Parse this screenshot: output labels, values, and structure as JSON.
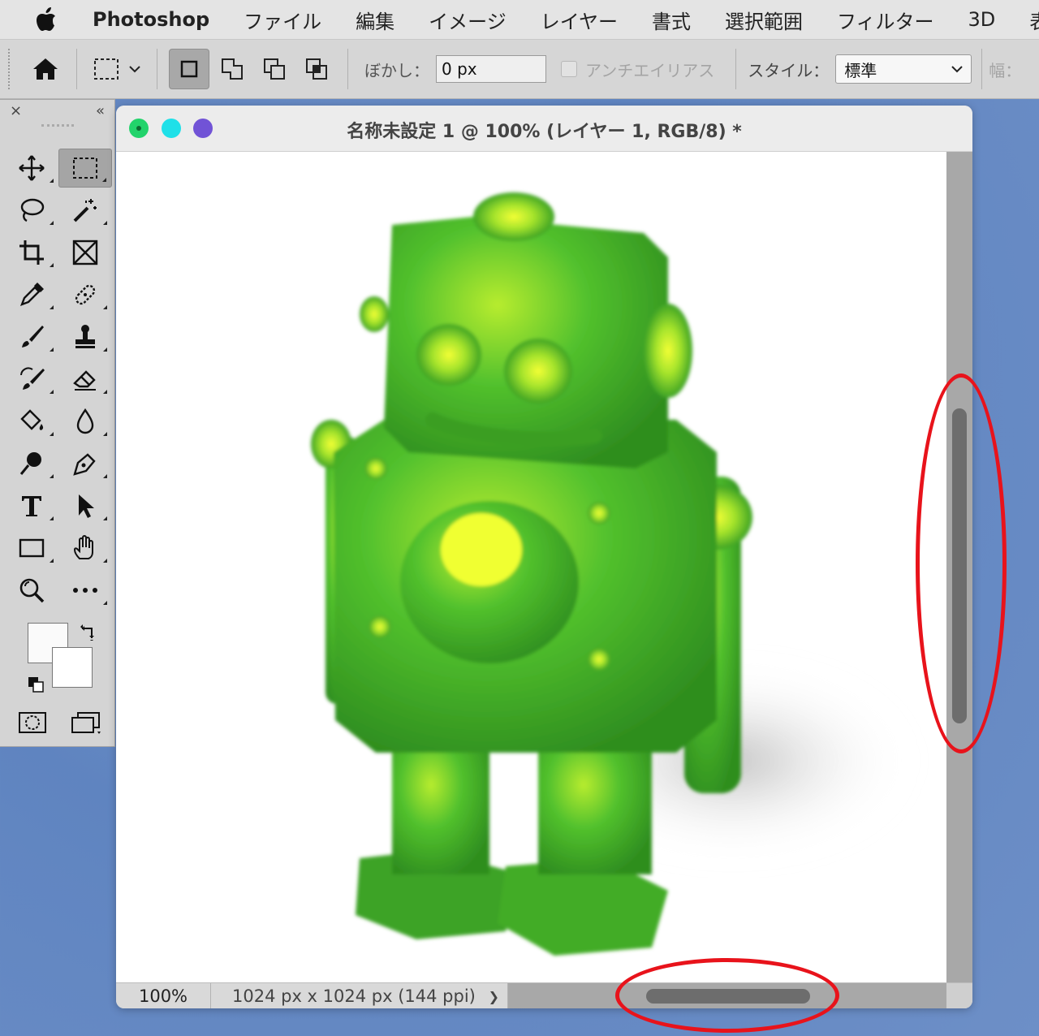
{
  "menubar": {
    "app_name": "Photoshop",
    "items": [
      "ファイル",
      "編集",
      "イメージ",
      "レイヤー",
      "書式",
      "選択範囲",
      "フィルター",
      "3D",
      "表"
    ]
  },
  "options": {
    "feather_label": "ぼかし：",
    "feather_value": "0 px",
    "antialias_label": "アンチエイリアス",
    "style_label": "スタイル：",
    "style_value": "標準",
    "width_label": "幅："
  },
  "document": {
    "title": "名称未設定 1 @ 100% (レイヤー 1, RGB/8) *",
    "zoom": "100%",
    "info": "1024 px x 1024 px (144 ppi)",
    "info_arrow": "❯"
  },
  "icons": {
    "apple": "apple-icon",
    "home": "home-icon",
    "tools_close": "×",
    "tools_collapse": "«"
  },
  "colors": {
    "accent_annotation": "#e8131b",
    "robot_green": "#4cba2c",
    "robot_highlight": "#e6f52a",
    "traffic_green": "#22d36b",
    "traffic_cyan": "#1fe0e8",
    "traffic_purple": "#7153d6"
  }
}
